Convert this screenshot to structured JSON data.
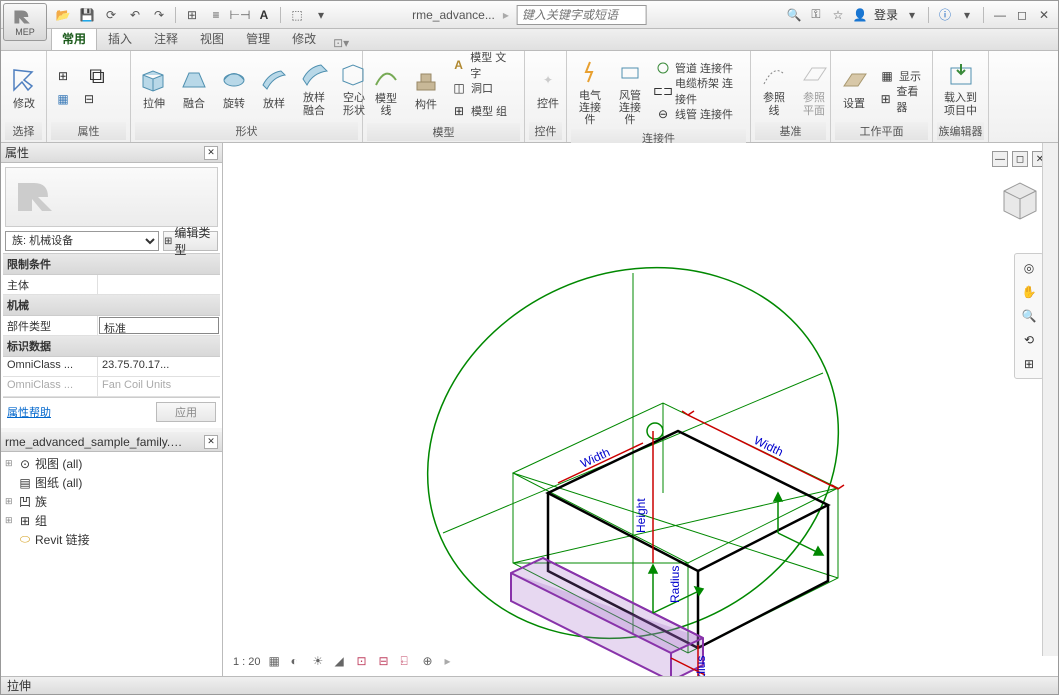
{
  "app": {
    "name": "MEP",
    "doc_title": "rme_advance...",
    "search_placeholder": "键入关键字或短语",
    "login": "登录"
  },
  "tabs": [
    "常用",
    "插入",
    "注释",
    "视图",
    "管理",
    "修改"
  ],
  "ribbon": {
    "select": {
      "label": "选择",
      "modify": "修改"
    },
    "props": {
      "label": "属性"
    },
    "shape": {
      "label": "形状",
      "items": [
        "拉伸",
        "融合",
        "旋转",
        "放样",
        "放样\n融合",
        "空心\n形状"
      ]
    },
    "model": {
      "label": "模型",
      "line": "模型\n线",
      "component": "构件",
      "text": "模型 文字",
      "opening": "洞口",
      "group": "模型 组"
    },
    "control": {
      "label": "控件",
      "item": "控件"
    },
    "connectors": {
      "label": "连接件",
      "elec": "电气\n连接件",
      "duct": "风管\n连接件",
      "pipe": "管道 连接件",
      "cable": "电缆桥架 连接件",
      "conduit": "线管 连接件"
    },
    "datum": {
      "label": "基准",
      "ref_line": "参照\n线",
      "ref_plane": "参照\n平面"
    },
    "workplane": {
      "label": "工作平面",
      "set": "设置",
      "show": "显示",
      "viewer": "查看器"
    },
    "family": {
      "label": "族编辑器",
      "load": "载入到\n项目中"
    }
  },
  "properties": {
    "title": "属性",
    "type_selector": "族: 机械设备",
    "edit_type": "编辑类型",
    "cats": {
      "constraints": "限制条件",
      "host": "主体",
      "mech": "机械",
      "part_type_k": "部件类型",
      "part_type_v": "标准",
      "id_data": "标识数据",
      "omni_num_k": "OmniClass ...",
      "omni_num_v": "23.75.70.17...",
      "omni_title_k": "OmniClass ...",
      "omni_title_v": "Fan Coil Units"
    },
    "help": "属性帮助",
    "apply": "应用"
  },
  "browser": {
    "title": "rme_advanced_sample_family.rf...",
    "items": [
      {
        "exp": "⊞",
        "icon": "views",
        "label": "视图 (all)"
      },
      {
        "exp": "",
        "icon": "sheet",
        "label": "图纸 (all)"
      },
      {
        "exp": "⊞",
        "icon": "family",
        "label": "族"
      },
      {
        "exp": "⊞",
        "icon": "group",
        "label": "组"
      },
      {
        "exp": "",
        "icon": "link",
        "label": "Revit 链接"
      }
    ]
  },
  "canvas": {
    "scale": "1 : 20"
  },
  "status": "拉伸",
  "drawing": {
    "dims": [
      "Width",
      "Height",
      "Radius",
      "Radius"
    ],
    "colors": {
      "circle": "#008800",
      "box": "#000",
      "hilite": "#008800",
      "dim": "#cc0000",
      "label": "#0000cc",
      "sel": "#8833aa"
    }
  }
}
